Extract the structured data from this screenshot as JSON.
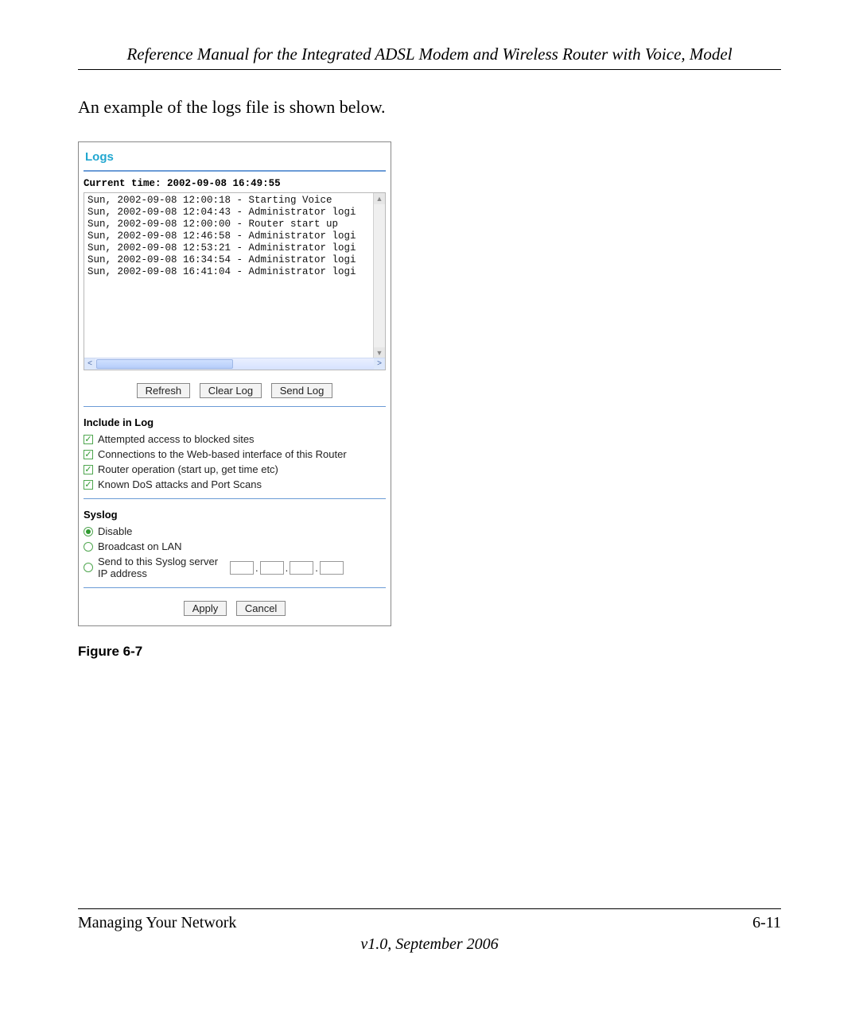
{
  "header": {
    "title": "Reference Manual for the Integrated ADSL Modem and Wireless Router with Voice, Model"
  },
  "body_text": "An example of the logs file is shown below.",
  "screenshot": {
    "panel_title": "Logs",
    "current_time_label": "Current time:",
    "current_time_value": "2002-09-08 16:49:55",
    "log_lines": [
      "Sun, 2002-09-08 12:00:18 - Starting Voice",
      "Sun, 2002-09-08 12:04:43 - Administrator logi",
      "Sun, 2002-09-08 12:00:00 - Router start up",
      "Sun, 2002-09-08 12:46:58 - Administrator logi",
      "Sun, 2002-09-08 12:53:21 - Administrator logi",
      "Sun, 2002-09-08 16:34:54 - Administrator logi",
      "Sun, 2002-09-08 16:41:04 - Administrator logi"
    ],
    "buttons": {
      "refresh": "Refresh",
      "clear": "Clear Log",
      "send": "Send Log",
      "apply": "Apply",
      "cancel": "Cancel"
    },
    "include_heading": "Include in Log",
    "include_options": [
      "Attempted access to blocked sites",
      "Connections to the Web-based interface of this Router",
      "Router operation (start up, get time etc)",
      "Known DoS attacks and Port Scans"
    ],
    "syslog_heading": "Syslog",
    "syslog_options": {
      "disable": "Disable",
      "broadcast": "Broadcast on LAN",
      "send_ip": "Send to this Syslog server IP address"
    }
  },
  "figure_caption": "Figure 6-7",
  "footer": {
    "section": "Managing Your Network",
    "page": "6-11",
    "version": "v1.0, September 2006"
  }
}
